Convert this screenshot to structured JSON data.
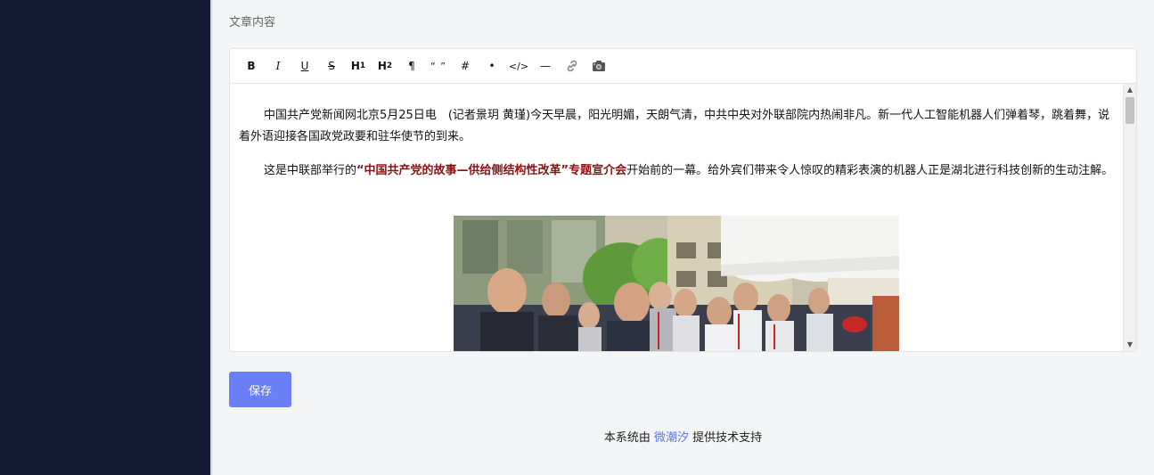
{
  "section_label": "文章内容",
  "toolbar": {
    "bold": "B",
    "italic": "I",
    "underline": "U",
    "strike": "S",
    "h1": "H",
    "h1_sub": "1",
    "h2": "H",
    "h2_sub": "2",
    "paragraph": "¶",
    "quote": "“ ”",
    "hash": "#",
    "bullet": "•",
    "code": "</>",
    "hr": "—",
    "link_icon": "link-icon",
    "image_icon": "camera-icon"
  },
  "content": {
    "p1": "中国共产党新闻网北京5月25日电　(记者景玥 黄瑾)今天早晨，阳光明媚，天朗气清，中共中央对外联部院内热闹非凡。新一代人工智能机器人们弹着琴，跳着舞，说着外语迎接各国政党政要和驻华使节的到来。",
    "p2_before": "这是中联部举行的",
    "p2_highlight": "“中国共产党的故事—供给侧结构性改革”专题宣介会",
    "p2_after": "开始前的一幕。给外宾们带来令人惊叹的精彩表演的机器人正是湖北进行科技创新的生动注解。"
  },
  "save_label": "保存",
  "footer": {
    "before": "本系统由",
    "link": "微潮汐",
    "after": "提供技术支持"
  },
  "colors": {
    "sidebar": "#141a33",
    "accent": "#6a7ef5",
    "highlight": "#8b1010",
    "link": "#5c73f2"
  }
}
